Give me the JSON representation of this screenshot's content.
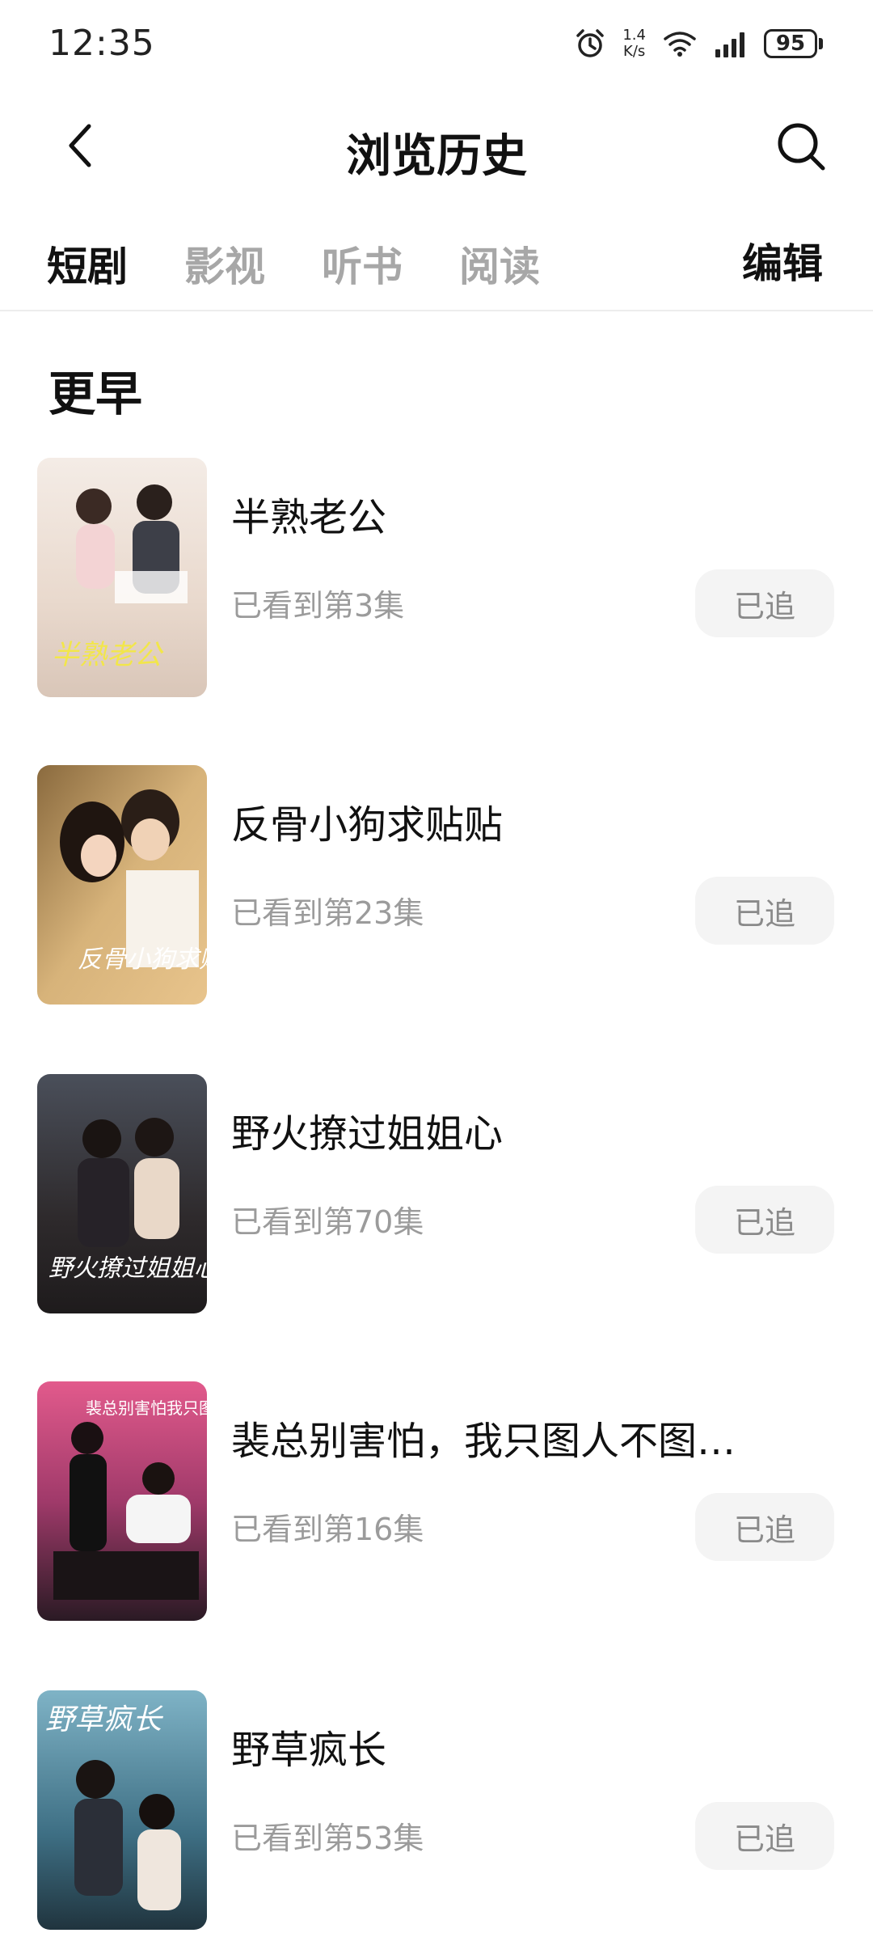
{
  "status_bar": {
    "time": "12:35",
    "speed_value": "1.4",
    "speed_unit": "K/s",
    "battery": "95",
    "icons": [
      "alarm-icon",
      "wifi-icon",
      "signal-icon",
      "battery-icon"
    ]
  },
  "header": {
    "title": "浏览历史",
    "back_icon": "chevron-left-icon",
    "search_icon": "search-icon"
  },
  "tabs": {
    "items": [
      {
        "label": "短剧",
        "active": true
      },
      {
        "label": "影视",
        "active": false
      },
      {
        "label": "听书",
        "active": false
      },
      {
        "label": "阅读",
        "active": false
      }
    ],
    "edit_label": "编辑"
  },
  "section": {
    "title": "更早"
  },
  "items": [
    {
      "title": "半熟老公",
      "progress": "已看到第3集",
      "follow_label": "已追",
      "poster_caption": "半熟老公"
    },
    {
      "title": "反骨小狗求贴贴",
      "progress": "已看到第23集",
      "follow_label": "已追",
      "poster_caption": "反骨小狗求贴"
    },
    {
      "title": "野火撩过姐姐心",
      "progress": "已看到第70集",
      "follow_label": "已追",
      "poster_caption": "野火撩过姐姐心"
    },
    {
      "title": "裴总别害怕，我只图人不图…",
      "progress": "已看到第16集",
      "follow_label": "已追",
      "poster_caption": "裴总别害怕我只图人不图钱"
    },
    {
      "title": "野草疯长",
      "progress": "已看到第53集",
      "follow_label": "已追",
      "poster_caption": "野草疯长"
    }
  ],
  "colors": {
    "accent": "#111111",
    "muted": "#a7a7a7",
    "button_bg": "#f4f4f4"
  }
}
